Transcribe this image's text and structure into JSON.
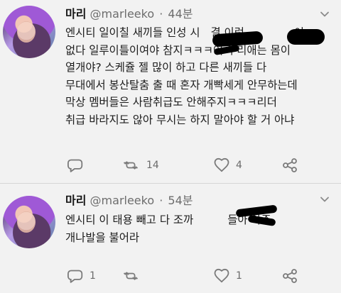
{
  "tweets": [
    {
      "name": "마리",
      "handle": "@marleeko",
      "separator": "·",
      "time": "44분",
      "lines": [
        "엔시티 일이칠 새끼들 인성 시",
        "없다 일루이틀이여야 참지ㅋㅋㅋ어 우리애는 몸이",
        "열개야? 스케쥴 젤 많이 하고 다른 새끼들 다",
        "무대에서 봉산탈춤 출 때 혼자 개빡세게 안무하는데",
        "막상 멤버들은 사람취급도 안해주지ㅋㅋㅋ리더",
        "취급 바라지도 않아 무시는 하지 말아야 할 거 아냐"
      ],
      "line_extra": {
        "partial_1": "결 이런",
        "partial_2": "이"
      },
      "actions": {
        "reply_count": "",
        "retweet_count": "14",
        "like_count": "4"
      }
    },
    {
      "name": "마리",
      "handle": "@marleeko",
      "separator": "·",
      "time": "54분",
      "lines": [
        "엔시티 이 태용 빼고 다 조까",
        "개나발을 불어라"
      ],
      "line_extra": {
        "partial_1": "들아 아주"
      },
      "actions": {
        "reply_count": "1",
        "retweet_count": "",
        "like_count": "1"
      }
    }
  ],
  "icons": {
    "reply": "reply-icon",
    "retweet": "retweet-icon",
    "like": "heart-icon",
    "share": "share-icon",
    "menu": "chevron-down-icon"
  },
  "colors": {
    "background": "#f2f2f2",
    "text": "#1c1c1c",
    "muted": "#6d6d6d",
    "icon": "#777777",
    "redaction": "#000000"
  }
}
